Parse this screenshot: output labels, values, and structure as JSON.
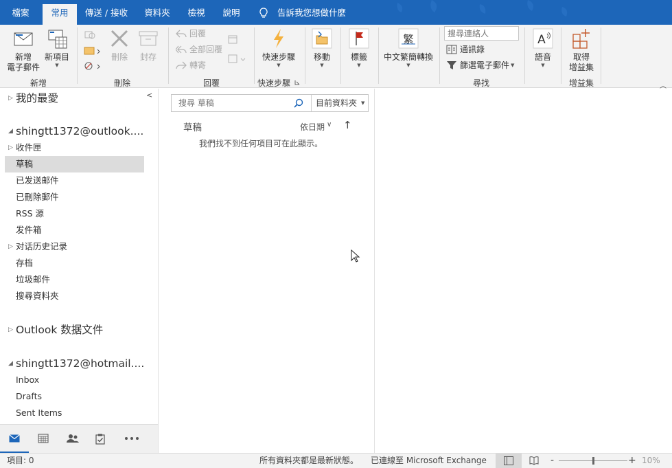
{
  "ribbon": {
    "tabs": [
      {
        "label": "檔案",
        "active": false
      },
      {
        "label": "常用",
        "active": true
      },
      {
        "label": "傳送 / 接收",
        "active": false
      },
      {
        "label": "資料夾",
        "active": false
      },
      {
        "label": "檢視",
        "active": false
      },
      {
        "label": "說明",
        "active": false
      }
    ],
    "tell_me": "告訴我您想做什麼",
    "new": {
      "new_email_line1": "新增",
      "new_email_line2": "電子郵件",
      "new_items": "新項目",
      "group": "新增"
    },
    "delete": {
      "delete": "刪除",
      "archive": "封存",
      "group": "刪除"
    },
    "respond": {
      "reply": "回覆",
      "reply_all": "全部回覆",
      "forward": "轉寄",
      "group": "回覆"
    },
    "quicksteps": {
      "label": "快速步驟",
      "group": "快速步驟"
    },
    "move": {
      "label": "移動"
    },
    "tags": {
      "label": "標籤"
    },
    "chinese": {
      "label": "中文繁簡轉換"
    },
    "find": {
      "search_people_placeholder": "搜尋連絡人",
      "address_book": "通訊錄",
      "filter_email": "篩選電子郵件",
      "group": "尋找"
    },
    "speech": {
      "label": "語音"
    },
    "addins": {
      "line1": "取得",
      "line2": "增益集",
      "group": "增益集"
    }
  },
  "folders": {
    "favorites": "我的最愛",
    "account1": "shingtt1372@outlook....",
    "account1_items": [
      {
        "label": "收件匣",
        "expandable": true,
        "selected": false
      },
      {
        "label": "草稿",
        "expandable": false,
        "selected": true
      },
      {
        "label": "已发送邮件",
        "expandable": false,
        "selected": false
      },
      {
        "label": "已刪除郵件",
        "expandable": false,
        "selected": false
      },
      {
        "label": "RSS 源",
        "expandable": false,
        "selected": false
      },
      {
        "label": "发件箱",
        "expandable": false,
        "selected": false
      },
      {
        "label": "对话历史记录",
        "expandable": true,
        "selected": false
      },
      {
        "label": "存档",
        "expandable": false,
        "selected": false
      },
      {
        "label": "垃圾邮件",
        "expandable": false,
        "selected": false
      },
      {
        "label": "搜尋資料夾",
        "expandable": false,
        "selected": false
      }
    ],
    "data_file": "Outlook 数据文件",
    "account2": "shingtt1372@hotmail....",
    "account2_items": [
      {
        "label": "Inbox"
      },
      {
        "label": "Drafts"
      },
      {
        "label": "Sent Items"
      }
    ]
  },
  "message_list": {
    "search_placeholder": "搜尋 草稿",
    "scope": "目前資料夾",
    "folder_title": "草稿",
    "sort_by": "依日期",
    "empty_message": "我們找不到任何項目可在此顯示。"
  },
  "status": {
    "items": "項目: 0",
    "folders_state": "所有資料夾都是最新狀態。",
    "connection": "已連線至 Microsoft Exchange",
    "zoom_minus": "-",
    "zoom_plus": "+",
    "zoom_level": "10%",
    "zoom_fraction": 0.5
  },
  "colors": {
    "accent": "#1d66b9",
    "ribbon_bg": "#f3f3f3",
    "selected_folder": "#dcdcdc"
  }
}
